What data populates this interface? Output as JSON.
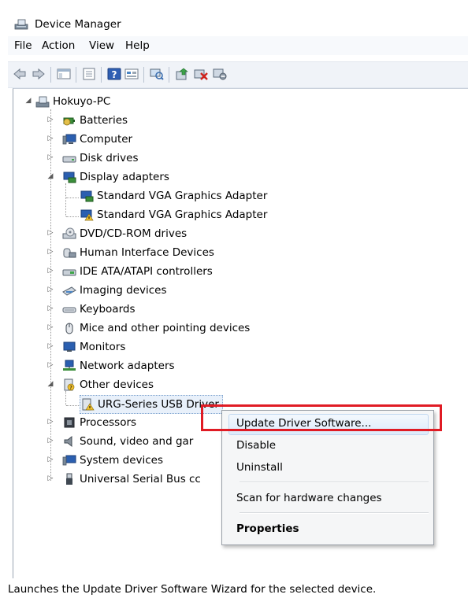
{
  "window": {
    "title": "Device Manager"
  },
  "menubar": [
    "File",
    "Action",
    "View",
    "Help"
  ],
  "toolbar": {
    "buttons": [
      "back-icon",
      "forward-icon",
      "console-tree-icon",
      "properties-icon",
      "help-icon",
      "view-icon",
      "scan-hardware-icon",
      "update-driver-icon",
      "uninstall-icon",
      "disable-icon"
    ]
  },
  "tree": {
    "root": "Hokuyo-PC",
    "items": [
      "Batteries",
      "Computer",
      "Disk drives",
      "Display adapters",
      "Standard VGA Graphics Adapter",
      "Standard VGA Graphics Adapter",
      "DVD/CD-ROM drives",
      "Human Interface Devices",
      "IDE ATA/ATAPI controllers",
      "Imaging devices",
      "Keyboards",
      "Mice and other pointing devices",
      "Monitors",
      "Network adapters",
      "Other devices",
      "URG-Series USB Driver",
      "Processors",
      "Sound, video and gar",
      "System devices",
      "Universal Serial Bus cc"
    ]
  },
  "context_menu": {
    "items": [
      "Update Driver Software...",
      "Disable",
      "Uninstall",
      "Scan for hardware changes",
      "Properties"
    ],
    "highlighted": "Update Driver Software..."
  },
  "statusbar": {
    "text": "Launches the Update Driver Software Wizard for the selected device."
  },
  "colors": {
    "highlight_box": "#e01b24",
    "selection": "#dcebfb"
  }
}
